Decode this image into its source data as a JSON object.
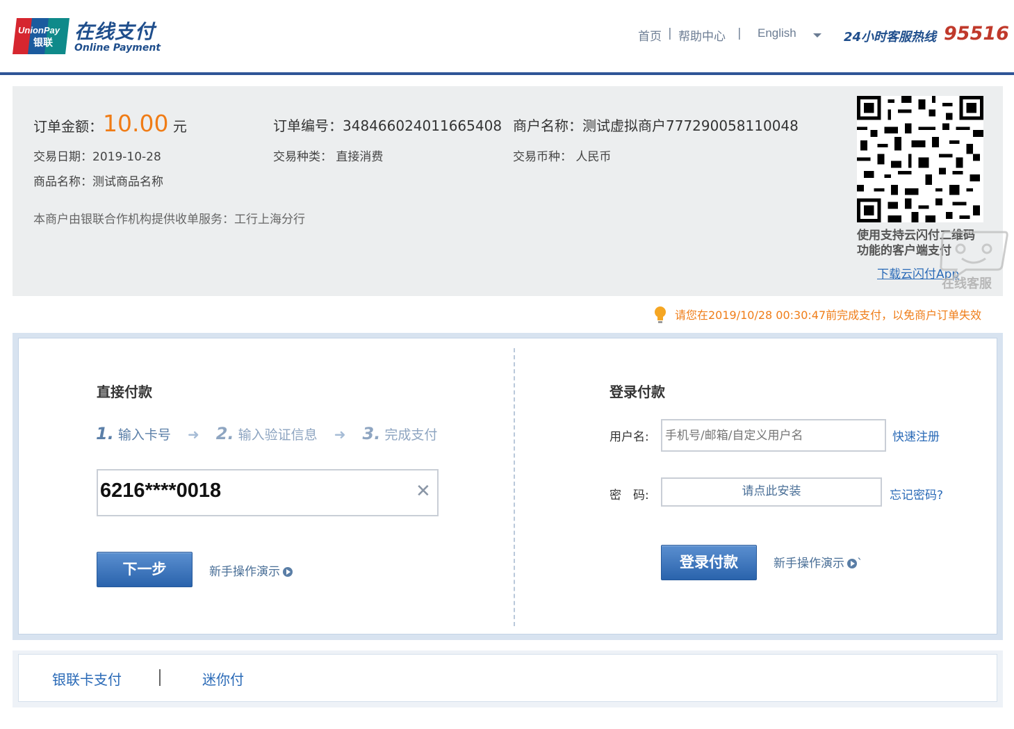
{
  "header": {
    "logo_badge_text_1": "UnionPay",
    "logo_badge_text_2": "银联",
    "logo_title": "在线支付",
    "logo_subtitle": "Online Payment",
    "nav": [
      {
        "label": "首页"
      },
      {
        "label": "帮助中心"
      },
      {
        "label": "English"
      }
    ],
    "hotline_label": "24小时客服热线",
    "hotline_number": "95516"
  },
  "order": {
    "amount_label": "订单金额：",
    "amount_value": "10.00",
    "amount_unit": "元",
    "order_no_label": "订单编号：",
    "order_no": "348466024011665408",
    "merchant_label": "商户名称：",
    "merchant_name": "测试虚拟商户777290058110048",
    "date_label": "交易日期：",
    "date_value": "2019-10-28",
    "type_label": "交易种类：",
    "type_value": "直接消费",
    "currency_label": "交易币种：",
    "currency_value": "人民币",
    "goods_label": "商品名称：",
    "goods_value": "测试商品名称",
    "acquirer_text": "本商户由银联合作机构提供收单服务：工行上海分行",
    "qr_caption_1": "使用支持云闪付二维码",
    "qr_caption_2": "功能的客户端支付",
    "qr_link": "下载云闪付App",
    "cs_label": "在线客服"
  },
  "notice": "请您在2019/10/28 00:30:47前完成支付，以免商户订单失效",
  "direct_pay": {
    "title": "直接付款",
    "steps": [
      {
        "num": "1.",
        "label": "输入卡号"
      },
      {
        "num": "2.",
        "label": "输入验证信息"
      },
      {
        "num": "3.",
        "label": "完成支付"
      }
    ],
    "card_number": "6216****0018",
    "clear_symbol": "✕",
    "next_button": "下一步",
    "demo_link": "新手操作演示"
  },
  "login_pay": {
    "title": "登录付款",
    "username_label": "用户名:",
    "username_placeholder": "手机号/邮箱/自定义用户名",
    "register_link": "快速注册",
    "password_label": "密　码:",
    "install_text": "请点此安装",
    "forgot_link": "忘记密码?",
    "login_button": "登录付款",
    "demo_link": "新手操作演示",
    "demo_suffix": "`"
  },
  "tabs": [
    {
      "label": "银联卡支付"
    },
    {
      "label": "迷你付"
    }
  ],
  "colors": {
    "brand_blue": "#2f5597",
    "amount_orange": "#f07c16",
    "hotline_red": "#c0392b",
    "link_blue": "#2a6ab7"
  }
}
